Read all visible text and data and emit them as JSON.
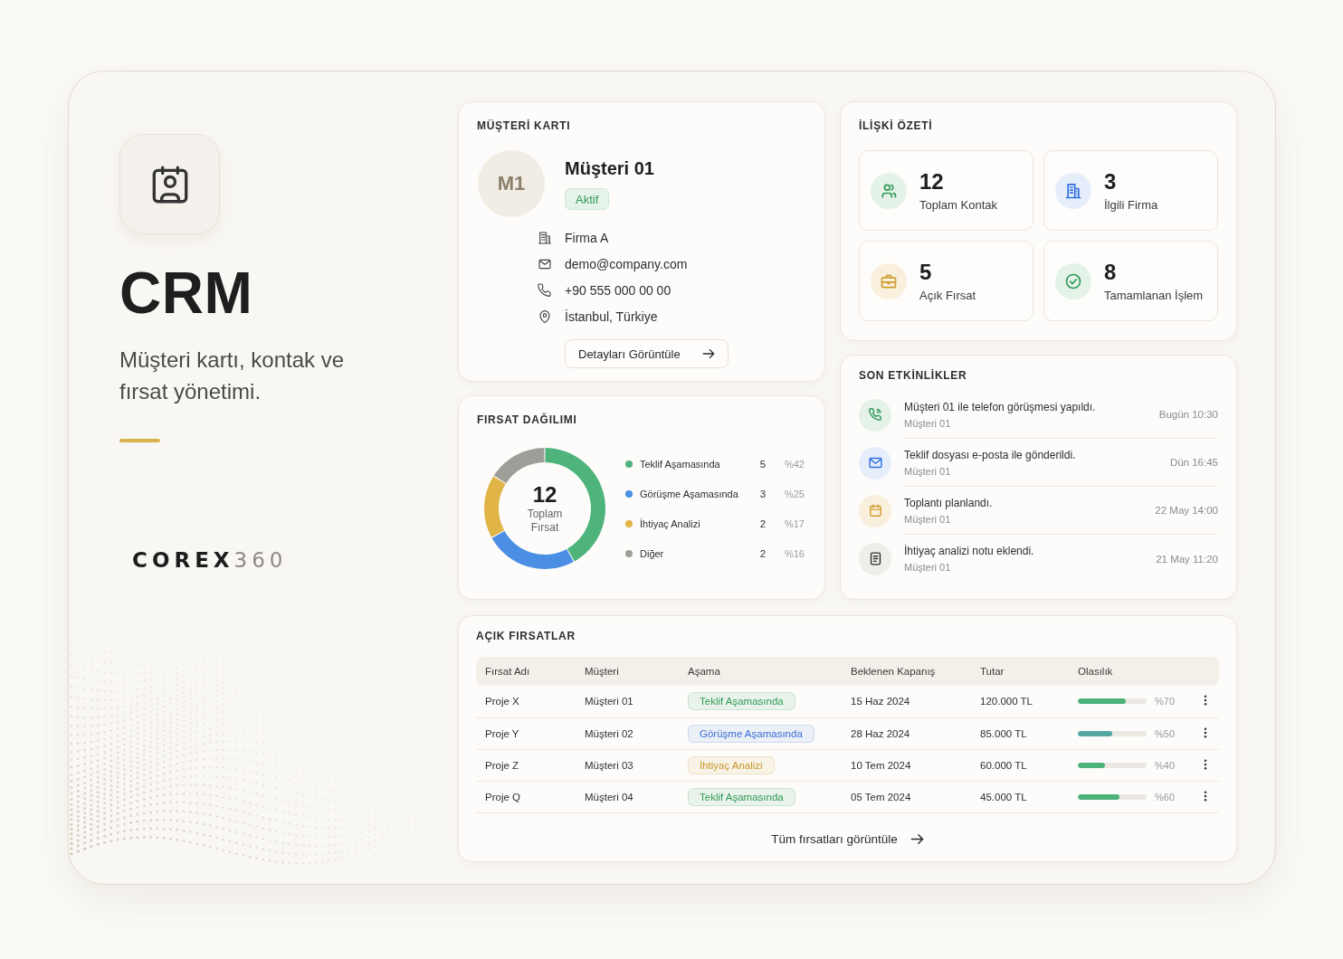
{
  "brand": {
    "title": "CRM",
    "subtitle": "Müşteri kartı, kontak ve fırsat yönetimi.",
    "logo": {
      "main": "COREX",
      "accent": "360"
    }
  },
  "customer_card": {
    "title": "MÜŞTERİ KARTI",
    "initials": "M1",
    "name": "Müşteri 01",
    "status": "Aktif",
    "details": [
      {
        "kind": "company",
        "text": "Firma A"
      },
      {
        "kind": "email",
        "text": "demo@company.com"
      },
      {
        "kind": "phone",
        "text": "+90 555 000 00 00"
      },
      {
        "kind": "location",
        "text": "İstanbul, Türkiye"
      }
    ],
    "button": "Detayları Görüntüle"
  },
  "relationship_summary": {
    "title": "İLİŞKİ ÖZETİ",
    "stats": [
      {
        "kind": "contacts",
        "value": "12",
        "label": "Toplam Kontak"
      },
      {
        "kind": "companies",
        "value": "3",
        "label": "İlgili Firma"
      },
      {
        "kind": "opportunities",
        "value": "5",
        "label": "Açık Fırsat"
      },
      {
        "kind": "completed",
        "value": "8",
        "label": "Tamamlanan İşlem"
      }
    ]
  },
  "opportunity_distribution": {
    "title": "FIRSAT DAĞILIMI",
    "total": "12",
    "total_label": "Toplam Fırsat",
    "counts": [
      "5",
      "3",
      "2",
      "2"
    ],
    "chart_data": {
      "type": "donut",
      "categories": [
        "Teklif Aşamasında",
        "Görüşme Aşamasında",
        "İhtiyaç Analizi",
        "Diğer"
      ],
      "values": [
        42,
        25,
        17,
        16
      ],
      "value_labels": [
        "%42",
        "%25",
        "%17",
        "%16"
      ],
      "colors": [
        "#4fb37c",
        "#4a8fe3",
        "#e0b447",
        "#9e9e98"
      ]
    }
  },
  "recent_activities": {
    "title": "SON ETKİNLİKLER",
    "items": [
      {
        "kind": "call",
        "text": "Müşteri 01 ile telefon görüşmesi yapıldı.",
        "customer": "Müşteri 01",
        "time": "Bugün 10:30"
      },
      {
        "kind": "email",
        "text": "Teklif dosyası e-posta ile gönderildi.",
        "customer": "Müşteri 01",
        "time": "Dün 16:45"
      },
      {
        "kind": "meeting",
        "text": "Toplantı planlandı.",
        "customer": "Müşteri 01",
        "time": "22 May 14:00"
      },
      {
        "kind": "note",
        "text": "İhtiyaç analizi notu eklendi.",
        "customer": "Müşteri 01",
        "time": "21 May 11:20"
      }
    ]
  },
  "open_opportunities": {
    "title": "AÇIK FIRSATLAR",
    "columns": [
      "Fırsat Adı",
      "Müşteri",
      "Aşama",
      "Beklenen Kapanış",
      "Tutar",
      "Olasılık"
    ],
    "rows": [
      {
        "name": "Proje X",
        "customer": "Müşteri 01",
        "stage": {
          "label": "Teklif Aşamasında",
          "color": "#2f9a55"
        },
        "close_date": "15 Haz 2024",
        "amount": "120.000 TL",
        "probability": {
          "level": 0.7,
          "label": "%70",
          "color": "#4cb27a"
        }
      },
      {
        "name": "Proje Y",
        "customer": "Müşteri 02",
        "stage": {
          "label": "Görüşme Aşamasında",
          "color": "#3a6fd8"
        },
        "close_date": "28 Haz 2024",
        "amount": "85.000 TL",
        "probability": {
          "level": 0.5,
          "label": "%50",
          "color": "#55a7a6"
        }
      },
      {
        "name": "Proje Z",
        "customer": "Müşteri 03",
        "stage": {
          "label": "İhtiyaç Analizi",
          "color": "#c8962a"
        },
        "close_date": "10 Tem 2024",
        "amount": "60.000 TL",
        "probability": {
          "level": 0.4,
          "label": "%40",
          "color": "#4cb27a"
        }
      },
      {
        "name": "Proje Q",
        "customer": "Müşteri 04",
        "stage": {
          "label": "Teklif Aşamasında",
          "color": "#2f9a55"
        },
        "close_date": "05 Tem 2024",
        "amount": "45.000 TL",
        "probability": {
          "level": 0.6,
          "label": "%60",
          "color": "#4cb27a"
        }
      }
    ],
    "footer_link": "Tüm fırsatları görüntüle"
  }
}
